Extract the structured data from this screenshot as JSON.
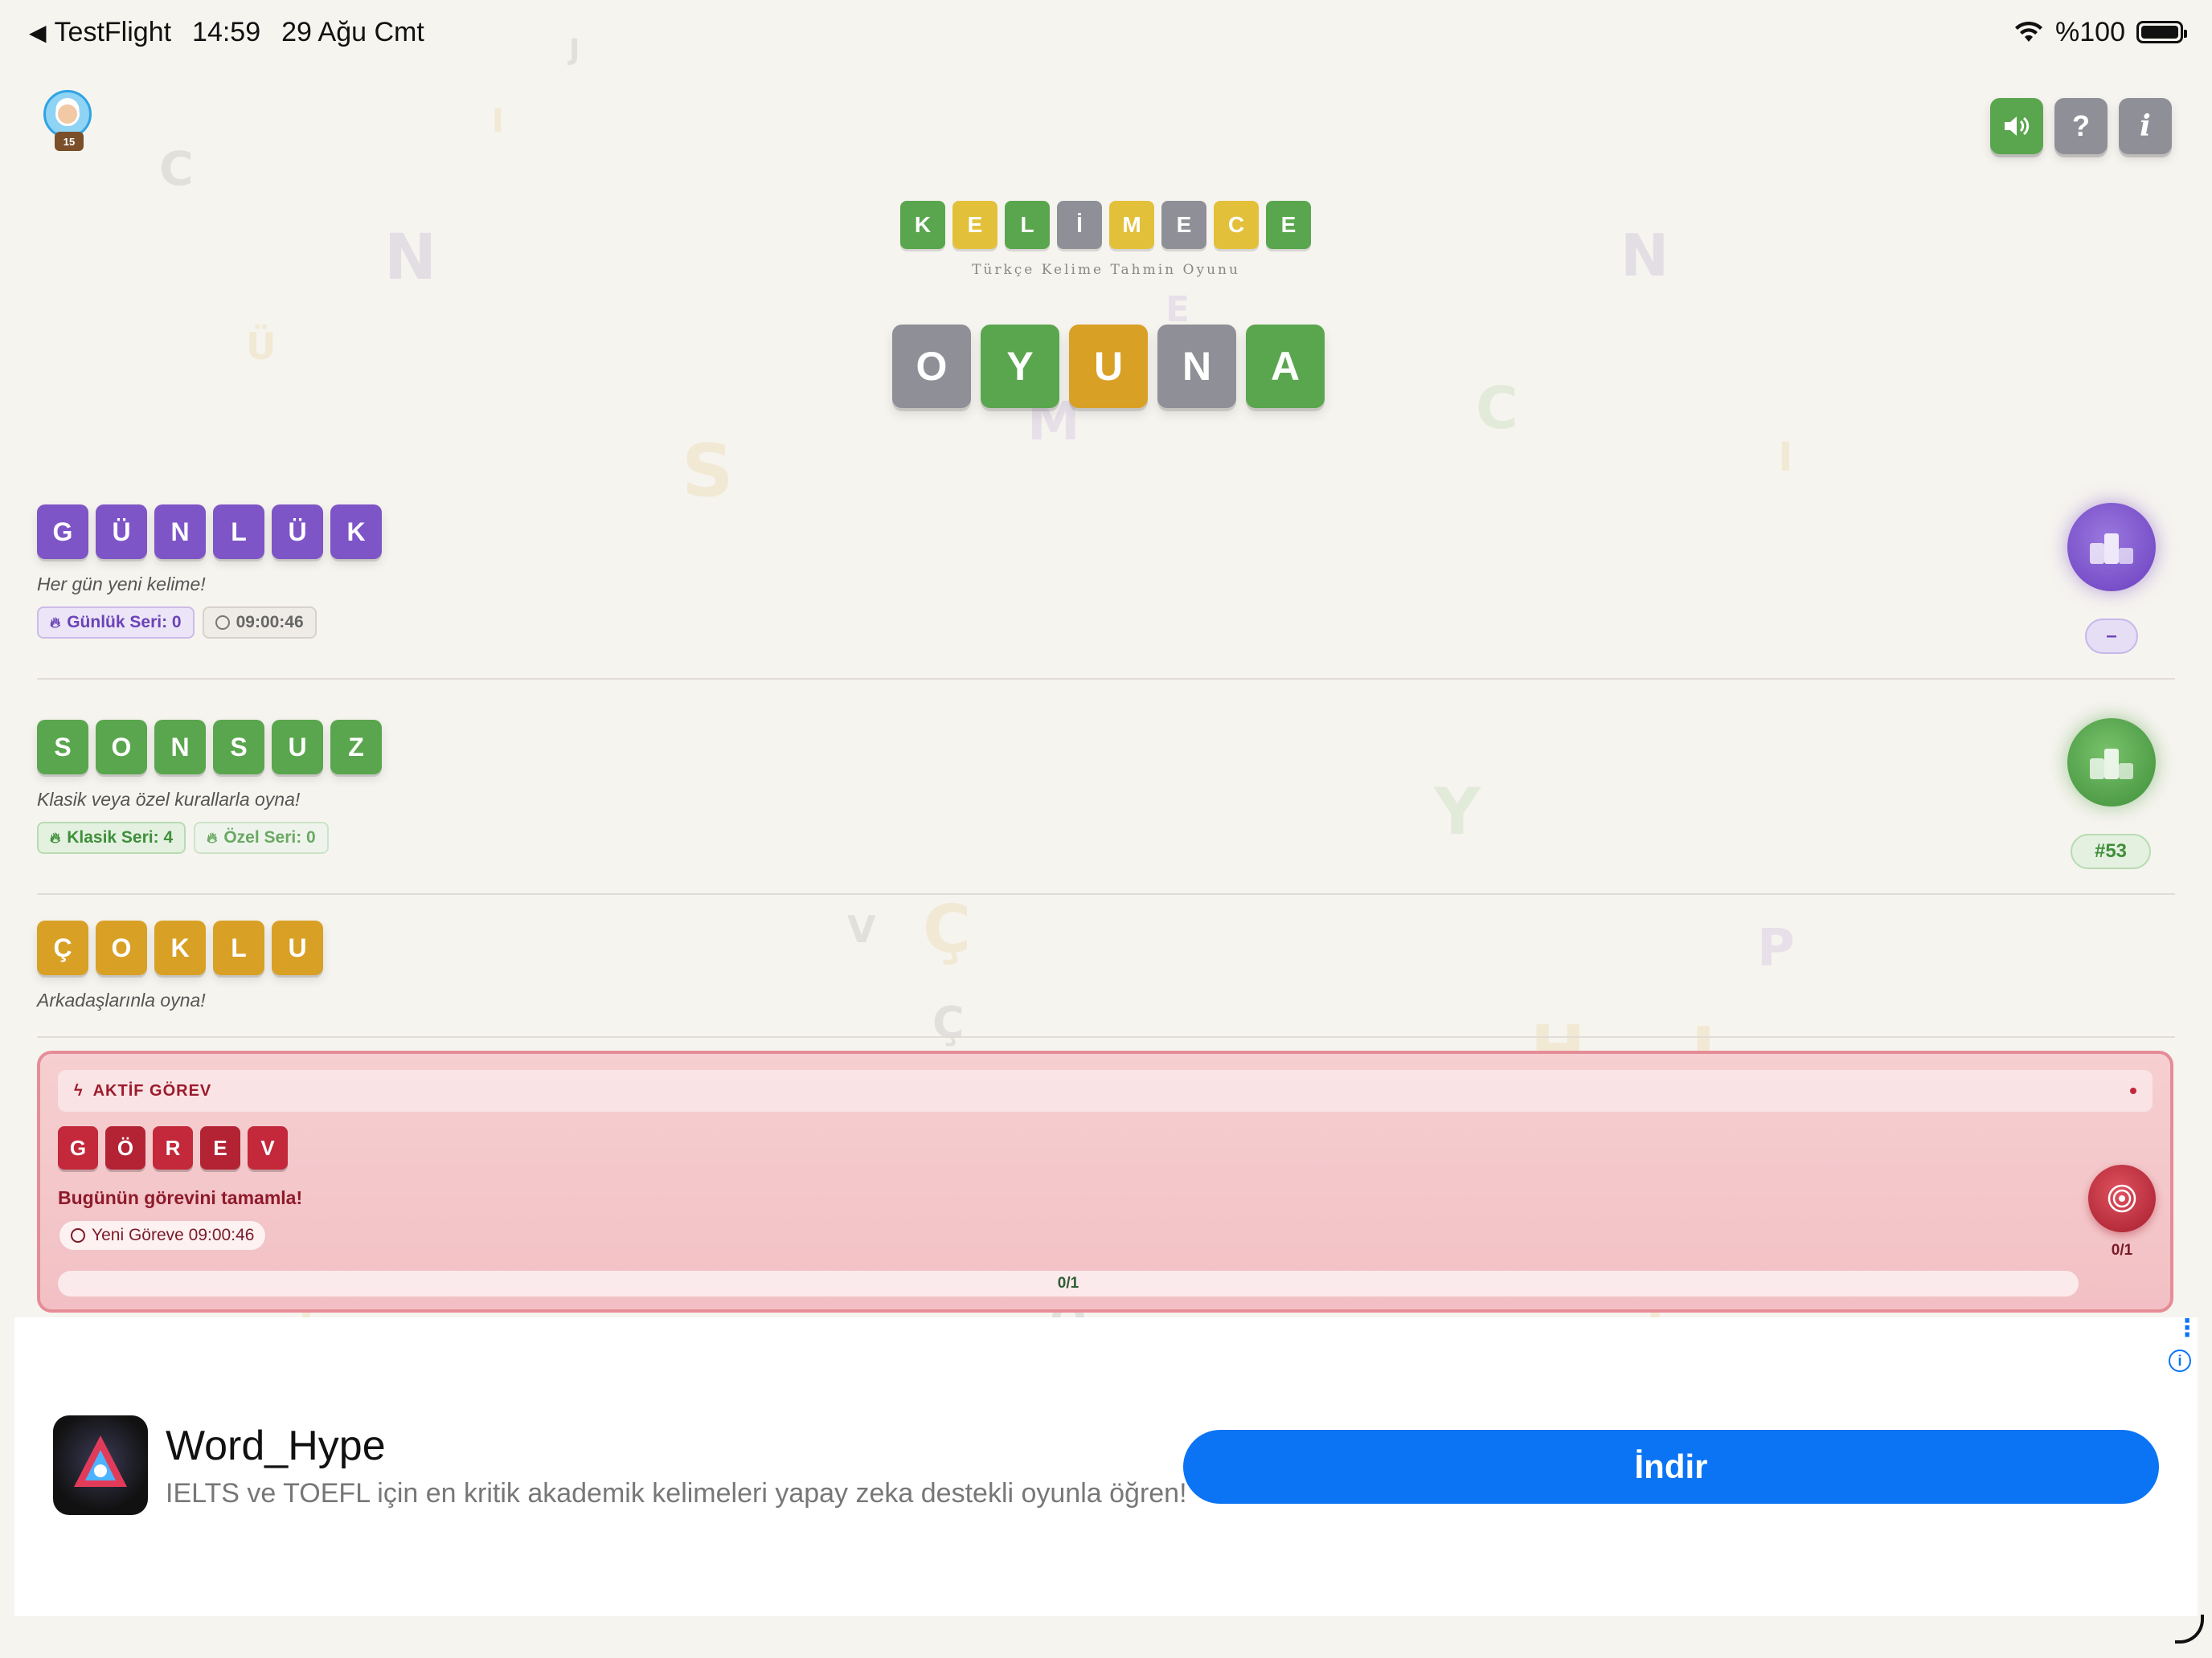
{
  "status_bar": {
    "back_app": "TestFlight",
    "time": "14:59",
    "date": "29 Ağu Cmt",
    "battery": "%100"
  },
  "avatar": {
    "level": "15"
  },
  "top_buttons": {
    "help": "?",
    "info": "i"
  },
  "logo": {
    "letters": [
      "K",
      "E",
      "L",
      "İ",
      "M",
      "E",
      "C",
      "E"
    ],
    "subtitle": "Türkçe Kelime Tahmin Oyunu"
  },
  "play": {
    "letters": [
      "O",
      "Y",
      "U",
      "N",
      "A"
    ]
  },
  "modes": {
    "daily": {
      "letters": [
        "G",
        "Ü",
        "N",
        "L",
        "Ü",
        "K"
      ],
      "subtitle": "Her gün yeni kelime!",
      "streak": "Günlük Seri: 0",
      "timer": "09:00:46",
      "rank": "–"
    },
    "endless": {
      "letters": [
        "S",
        "O",
        "N",
        "S",
        "U",
        "Z"
      ],
      "subtitle": "Klasik veya özel kurallarla oyna!",
      "classic_streak": "Klasik Seri: 4",
      "custom_streak": "Özel Seri: 0",
      "rank": "#53"
    },
    "multi": {
      "letters": [
        "Ç",
        "O",
        "K",
        "L",
        "U"
      ],
      "subtitle": "Arkadaşlarınla oyna!"
    }
  },
  "task": {
    "header": "AKTİF GÖREV",
    "letters": [
      "G",
      "Ö",
      "R",
      "E",
      "V"
    ],
    "title": "Bugünün görevini tamamla!",
    "next": "Yeni Göreve 09:00:46",
    "progress": "0/1",
    "progress_fraction": 0,
    "target_count": "0/1"
  },
  "ad": {
    "title": "Word_Hype",
    "description": "IELTS ve TOEFL için en kritik akademik kelimeleri yapay zeka destekli oyunla öğren!",
    "button": "İndir"
  },
  "colors": {
    "green": "#5aa64e",
    "yellow": "#e3c03a",
    "gray": "#8f9097",
    "orange": "#d9a026",
    "purple": "#7e55c6",
    "red": "#c3283b",
    "ad_blue": "#0a74f5"
  }
}
